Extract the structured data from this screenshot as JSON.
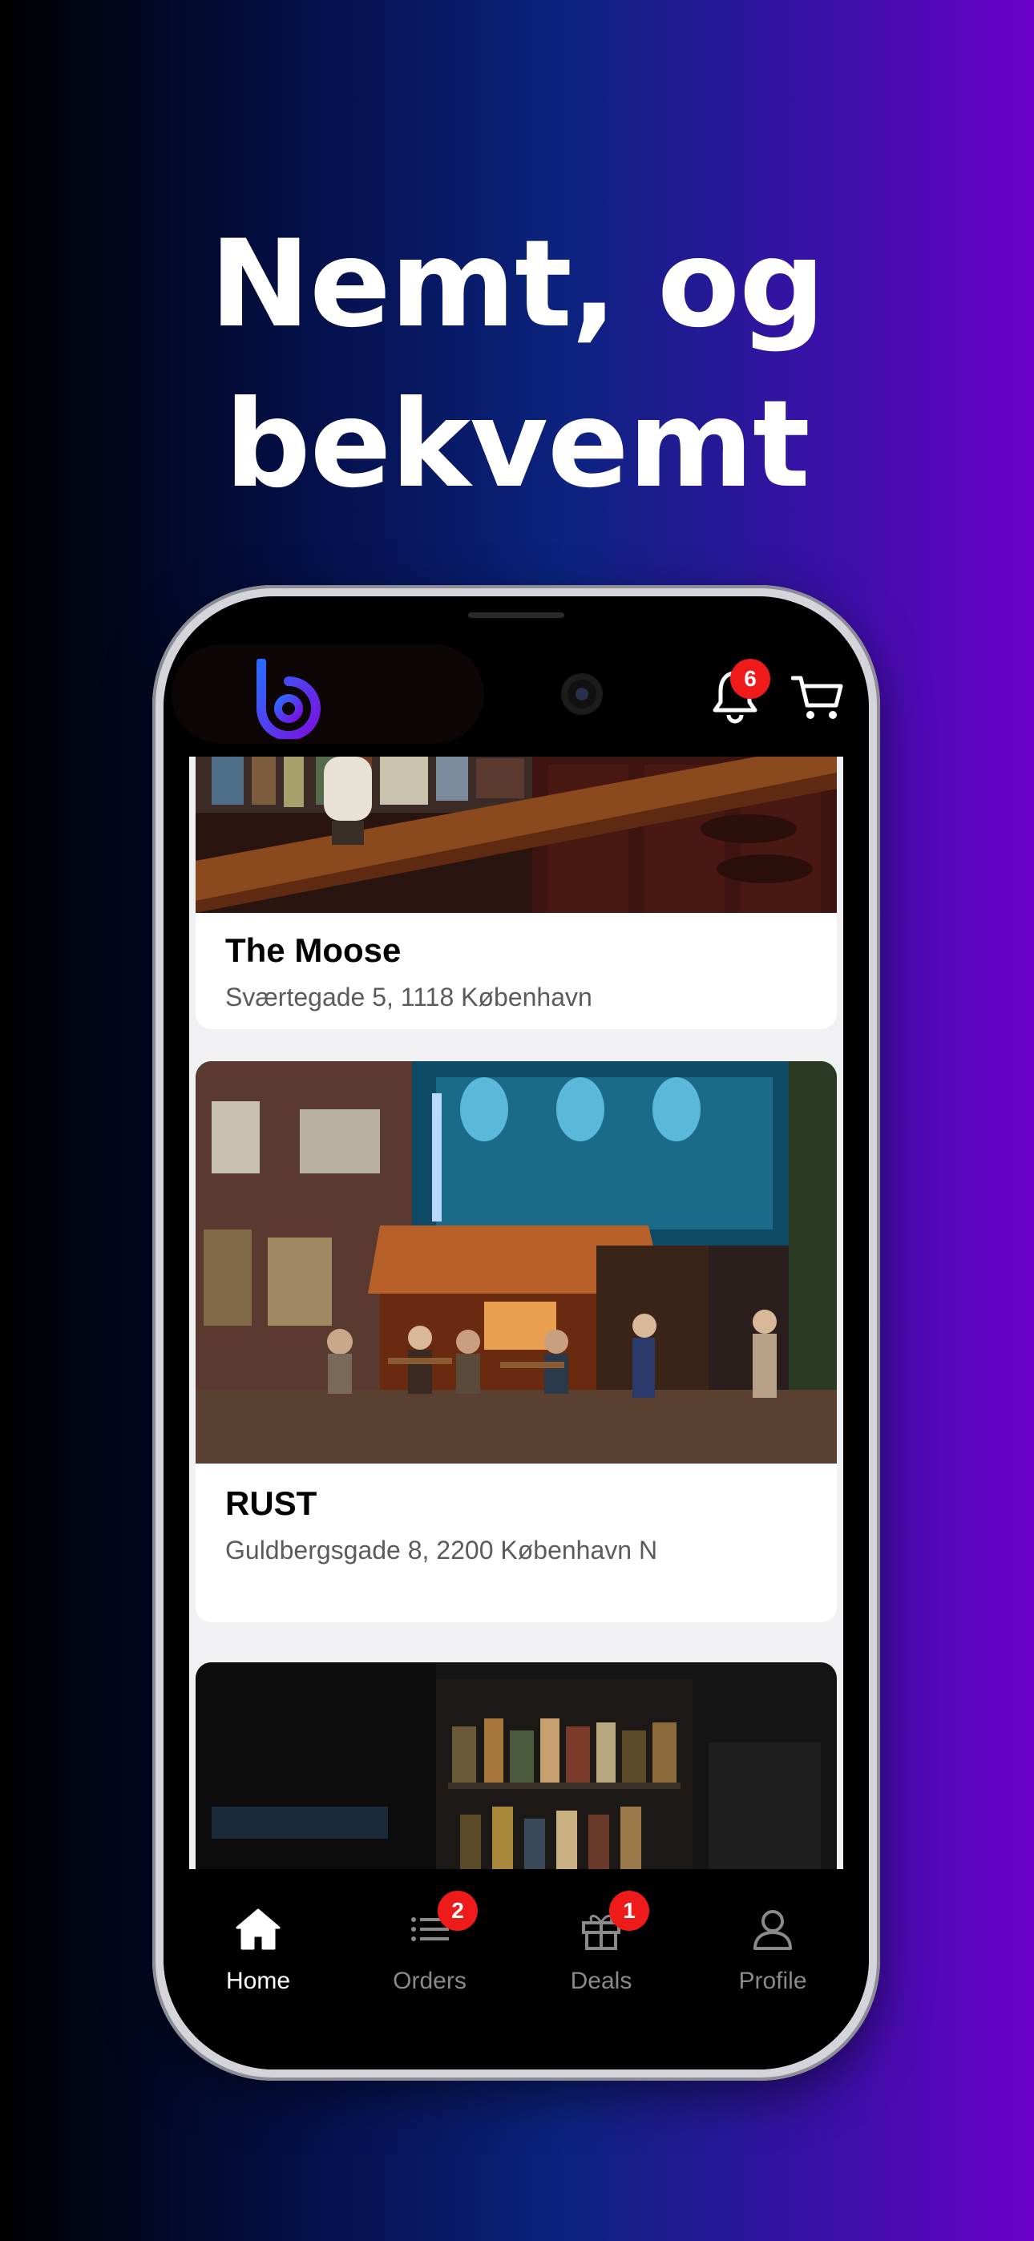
{
  "headline": {
    "line1": "Nemt, og",
    "line2": "bekvemt"
  },
  "header": {
    "logo_icon": "b-logo-icon",
    "notification_count": "6",
    "cart_icon": "cart-icon"
  },
  "venues": [
    {
      "name": "The Moose",
      "address": "Sværtegade 5, 1118 København"
    },
    {
      "name": "RUST",
      "address": "Guldbergsgade 8, 2200 København N"
    }
  ],
  "tabs": [
    {
      "label": "Home",
      "icon": "home-icon",
      "active": true
    },
    {
      "label": "Orders",
      "icon": "list-icon",
      "badge": "2"
    },
    {
      "label": "Deals",
      "icon": "gift-icon",
      "badge": "1"
    },
    {
      "label": "Profile",
      "icon": "person-icon"
    }
  ],
  "colors": {
    "badge": "#ef1b1b",
    "background_start": "#000000",
    "background_end": "#6a00c8",
    "logo_gradient": [
      "#2a6bff",
      "#7a10e0"
    ]
  }
}
